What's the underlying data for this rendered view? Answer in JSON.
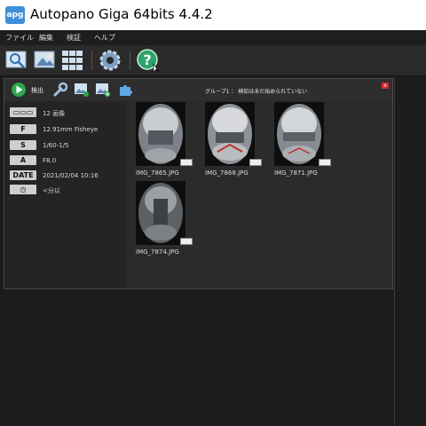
{
  "window": {
    "app_icon_text": "apg",
    "title": "Autopano Giga 64bits 4.4.2"
  },
  "menu": {
    "items": [
      "ファイル",
      "編集",
      "検証",
      "ヘルプ"
    ]
  },
  "group": {
    "detect_label": "検出",
    "title": "グループ1 ： 検知は未だ始められていない",
    "close_label": "x"
  },
  "info": {
    "rows": [
      {
        "badge": "▭▭▭",
        "value": "12 画像"
      },
      {
        "badge": "F",
        "value": "12.91mm Fisheye"
      },
      {
        "badge": "S",
        "value": "1/60-1/5"
      },
      {
        "badge": "A",
        "value": "F8.0"
      },
      {
        "badge": "DATE",
        "value": "2021/02/04 10:16"
      },
      {
        "badge": "◷",
        "value": "<分以"
      }
    ]
  },
  "images": [
    {
      "label": "IMG_7865.JPG"
    },
    {
      "label": "IMG_7868.JPG"
    },
    {
      "label": "IMG_7871.JPG"
    },
    {
      "label": "IMG_7874.JPG"
    }
  ],
  "colors": {
    "accent": "#3d8fd8",
    "close": "#d42c2c",
    "panel": "#2b2b2b",
    "background": "#1c1c1c"
  }
}
